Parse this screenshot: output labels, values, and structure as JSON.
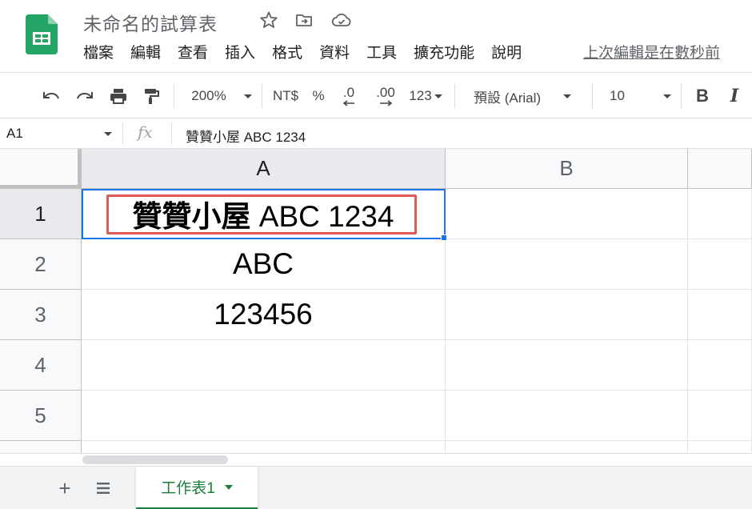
{
  "app": {
    "doc_title": "未命名的試算表",
    "logo_icon": "google-sheets-icon",
    "title_icons": [
      "star-icon",
      "move-folder-icon",
      "cloud-status-icon"
    ],
    "menu": [
      "檔案",
      "編輯",
      "查看",
      "插入",
      "格式",
      "資料",
      "工具",
      "擴充功能",
      "說明"
    ],
    "last_edit": "上次編輯是在數秒前",
    "accent_color": "#188038",
    "selection_color": "#1a73e8",
    "highlight_color": "#e05a5a"
  },
  "toolbar": {
    "undo_icon": "undo-icon",
    "redo_icon": "redo-icon",
    "print_icon": "print-icon",
    "paint_format_icon": "paint-format-icon",
    "zoom": "200%",
    "currency": "NT$",
    "percent": "%",
    "decimal_decrease": ".0",
    "decimal_increase": ".00",
    "more_formats": "123",
    "font": "預設 (Arial)",
    "font_size": "10",
    "bold": "B",
    "italic": "I"
  },
  "formula_bar": {
    "name_box": "A1",
    "fx": "fx",
    "content": "贊贊小屋 ABC 1234"
  },
  "grid": {
    "columns": [
      "A",
      "B",
      ""
    ],
    "rows": [
      {
        "label": "1",
        "a": "贊贊小屋",
        "a_latin": " ABC 1234",
        "b": ""
      },
      {
        "label": "2",
        "a": "ABC",
        "b": ""
      },
      {
        "label": "3",
        "a": "123456",
        "b": ""
      },
      {
        "label": "4",
        "a": "",
        "b": ""
      },
      {
        "label": "5",
        "a": "",
        "b": ""
      }
    ],
    "selected_cell": "A1"
  },
  "sheets": {
    "add_label": "+",
    "active_tab": "工作表1"
  }
}
